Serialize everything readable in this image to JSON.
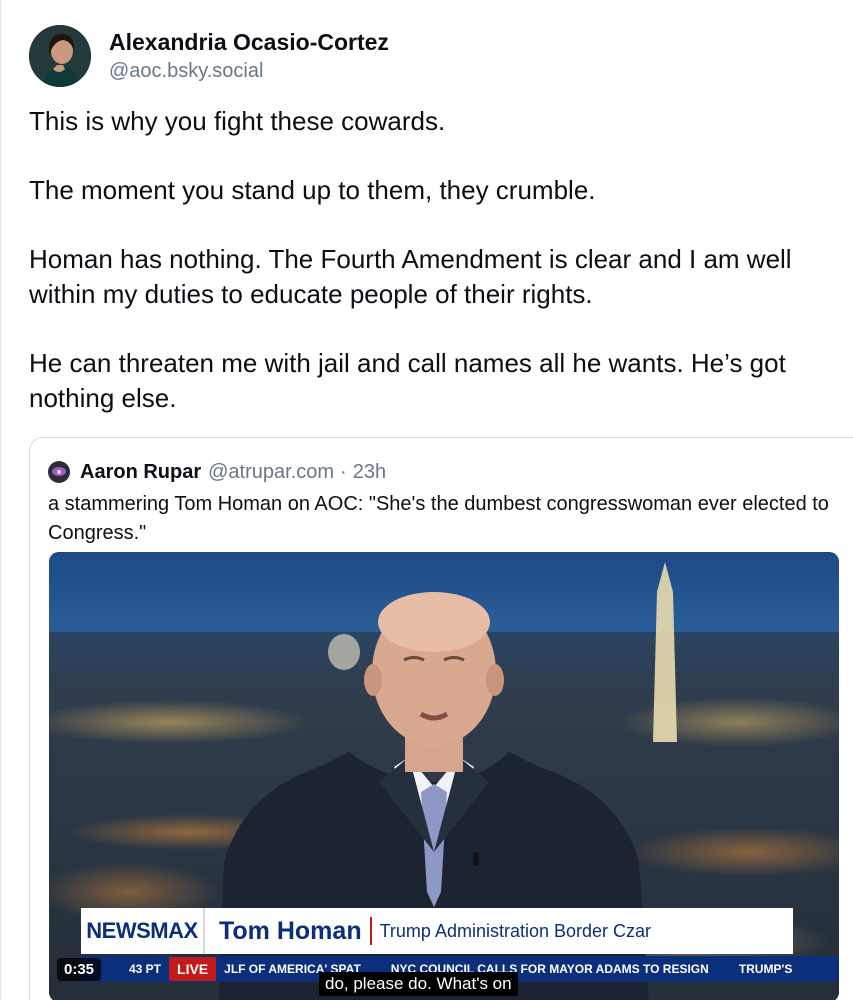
{
  "post": {
    "author": {
      "display_name": "Alexandria Ocasio-Cortez",
      "handle": "@aoc.bsky.social",
      "avatar_icon": "profile-photo"
    },
    "paragraphs": [
      "This is why you fight these cowards.",
      "The moment you stand up to them, they crumble.",
      "Homan has nothing. The Fourth Amendment is clear and I am well within my duties to educate people of their rights.",
      "He can threaten me with jail and call names all he wants. He’s got nothing else."
    ]
  },
  "quote": {
    "author_name": "Aaron Rupar",
    "handle": "@atrupar.com",
    "separator": "·",
    "time": "23h",
    "text": "a stammering Tom Homan on AOC: \"She's the dumbest congresswoman ever elected to Congress.\"",
    "video": {
      "network": "NEWSMAX",
      "name": "Tom Homan",
      "title": "Trump Administration Border Czar",
      "ticker_time": "43 PT",
      "live": "LIVE",
      "ticker_items": [
        "JLF OF AMERICA' SPAT",
        "NYC COUNCIL CALLS FOR MAYOR ADAMS TO RESIGN",
        "TRUMP'S"
      ],
      "timecode": "0:35",
      "caption": "do, please do. What's on"
    }
  },
  "colors": {
    "text": "#0b0f14",
    "muted": "#66788a",
    "border": "#d4dbe2",
    "newsmax_blue": "#0b2f7a",
    "live_red": "#c21b1b"
  }
}
